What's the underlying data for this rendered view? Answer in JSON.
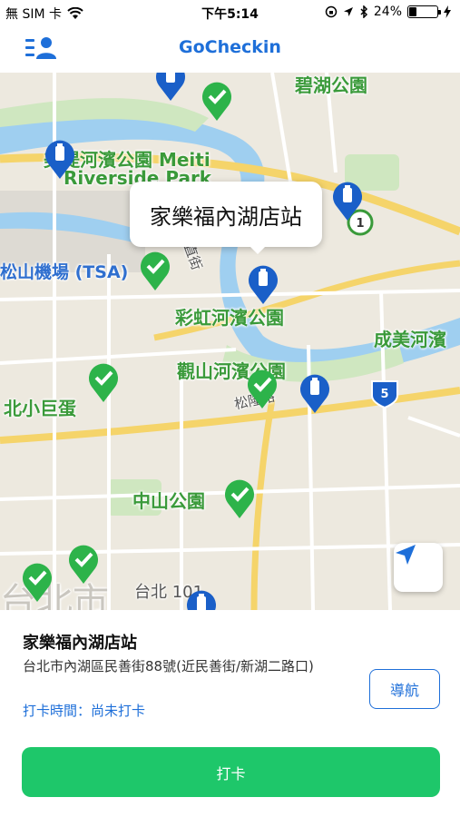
{
  "status_bar": {
    "carrier": "無 SIM 卡",
    "time": "下午5:14",
    "battery": "24%",
    "battery_level": 0.24
  },
  "nav": {
    "title": "GoCheckin"
  },
  "map": {
    "labels": {
      "bihu_park": "碧湖公園",
      "meiti_park": "美堤河濱公園 Meiti",
      "riverside_park": "Riverside Park",
      "songshan_airport": "松山機場 (TSA)",
      "rainbow_park": "彩虹河濱公園",
      "chengmei_park": "成美河濱",
      "guanshan_park": "觀山河濱公園",
      "xiaojudan": "北小巨蛋",
      "zhongshan_park": "中山公園",
      "taipei101": "台北 101",
      "road_1": "1",
      "road_5": "5",
      "street_songlong": "松隆路",
      "street_zuo": "大直街",
      "district_big": "台北市"
    },
    "callout": "家樂福內湖店站"
  },
  "panel": {
    "station_name": "家樂福內湖店站",
    "address": "台北市內湖區民善街88號(近民善街/新湖二路口)",
    "checkin_time": "打卡時間：尚未打卡",
    "navigate_label": "導航",
    "checkin_label": "打卡"
  },
  "colors": {
    "accent": "#1e6fd9",
    "checkin_green": "#1ec76a",
    "pin_green": "#2db34a",
    "pin_blue": "#1a5fc8"
  }
}
